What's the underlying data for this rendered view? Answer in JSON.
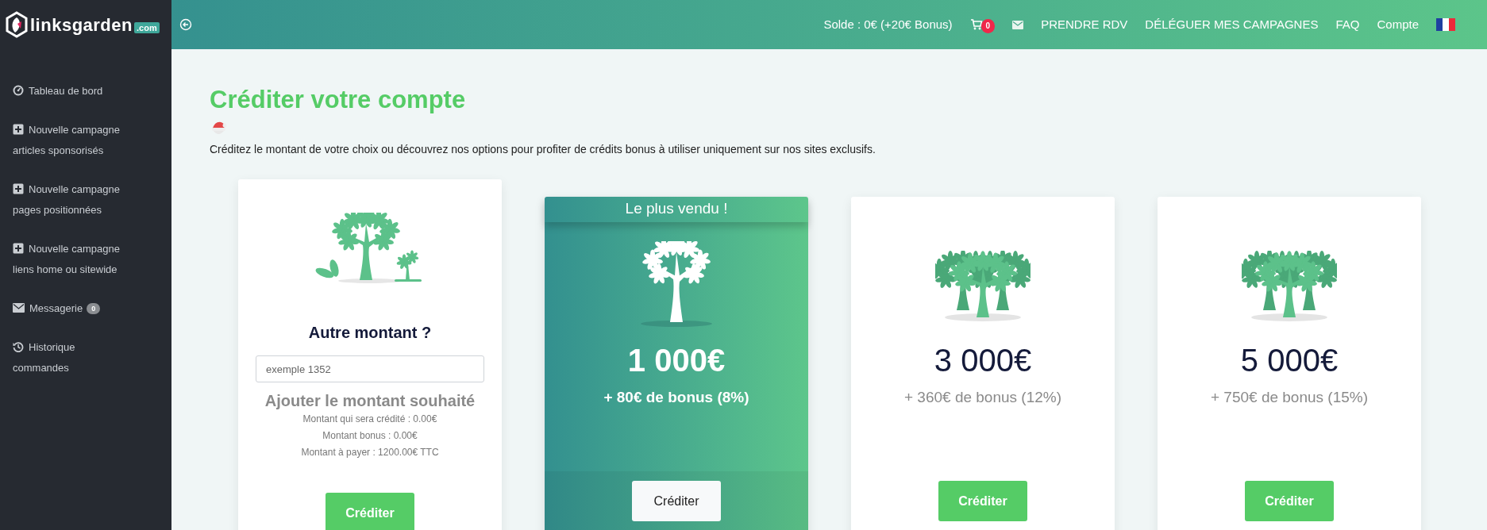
{
  "header": {
    "logo": {
      "name": "linksgarden",
      "suffix": ".com"
    },
    "balance": "Solde : 0€ (+20€ Bonus)",
    "cart_count": "0",
    "nav": [
      "PRENDRE RDV",
      "DÉLÉGUER MES CAMPAGNES",
      "FAQ",
      "Compte"
    ]
  },
  "sidebar": {
    "items": [
      {
        "kind": "dashboard",
        "label": "Tableau de bord"
      },
      {
        "kind": "new",
        "label": "Nouvelle campagne articles sponsorisés"
      },
      {
        "kind": "new",
        "label": "Nouvelle campagne pages positionnées"
      },
      {
        "kind": "new",
        "label": "Nouvelle campagne liens home ou sitewide"
      },
      {
        "kind": "messages",
        "label": "Messagerie",
        "badge": "0"
      },
      {
        "kind": "history",
        "label": "Historique commandes"
      }
    ]
  },
  "page": {
    "title": "Créditer votre compte",
    "subtitle": "Créditez le montant de votre choix ou découvrez nos options pour profiter de crédits bonus à utiliser uniquement sur nos sites exclusifs."
  },
  "offers": [
    {
      "kind": "custom",
      "heading": "Autre montant ?",
      "placeholder": "exemple 1352",
      "prompt": "Ajouter le montant souhaité",
      "details": [
        "Montant qui sera crédité : 0.00€",
        "Montant bonus : 0.00€",
        "Montant à payer : 1200.00€ TTC"
      ],
      "button": "Créditer"
    },
    {
      "kind": "pack",
      "featured": true,
      "ribbon": "Le plus vendu !",
      "amount": "1 000€",
      "bonus": "+ 80€ de bonus (8%)",
      "button": "Créditer"
    },
    {
      "kind": "pack",
      "featured": false,
      "amount": "3 000€",
      "bonus": "+ 360€ de bonus (12%)",
      "button": "Créditer"
    },
    {
      "kind": "pack",
      "featured": false,
      "amount": "5 000€",
      "bonus": "+ 750€ de bonus (15%)",
      "button": "Créditer"
    }
  ]
}
